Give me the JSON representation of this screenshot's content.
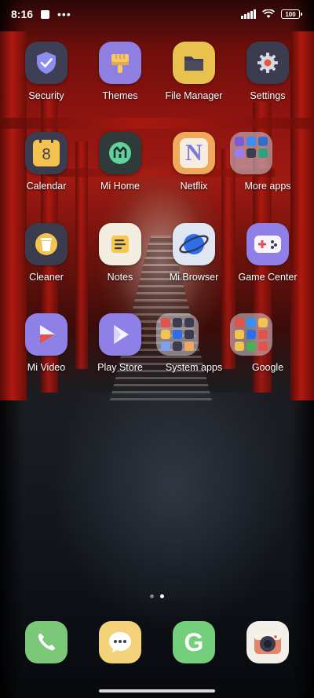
{
  "status_bar": {
    "time": "8:16",
    "battery": "100",
    "more_dots": "•••"
  },
  "apps": [
    {
      "label": "Security",
      "icon": "shield-icon"
    },
    {
      "label": "Themes",
      "icon": "paintbrush-icon"
    },
    {
      "label": "File Manager",
      "icon": "folder-icon"
    },
    {
      "label": "Settings",
      "icon": "gear-icon"
    },
    {
      "label": "Calendar",
      "icon": "calendar-icon",
      "day": "8"
    },
    {
      "label": "Mi Home",
      "icon": "mi-home-icon"
    },
    {
      "label": "Netflix",
      "icon": "netflix-icon",
      "letter": "N"
    },
    {
      "label": "More apps",
      "icon": "folder-grid-icon"
    },
    {
      "label": "Cleaner",
      "icon": "trash-icon"
    },
    {
      "label": "Notes",
      "icon": "notes-icon"
    },
    {
      "label": "Mi Browser",
      "icon": "planet-icon"
    },
    {
      "label": "Game Center",
      "icon": "gamepad-icon"
    },
    {
      "label": "Mi Video",
      "icon": "play-triangle-icon"
    },
    {
      "label": "Play Store",
      "icon": "play-store-icon"
    },
    {
      "label": "System apps",
      "icon": "folder-grid-icon"
    },
    {
      "label": "Google",
      "icon": "folder-grid-icon"
    }
  ],
  "dock": [
    {
      "name": "Phone",
      "icon": "phone-icon"
    },
    {
      "name": "Messages",
      "icon": "chat-bubble-icon"
    },
    {
      "name": "Google",
      "icon": "google-g-icon",
      "letter": "G"
    },
    {
      "name": "Camera",
      "icon": "camera-icon"
    }
  ],
  "page_indicator": {
    "pages": 2,
    "current": 2
  },
  "colors": {
    "security_tile": "#3e3f55",
    "themes_tile": "#8e7fe0",
    "file_manager_tile": "#e9c14f",
    "settings_tile": "#3b3c4f",
    "calendar_tile": "#3b3c4f",
    "mi_home_tile": "#2f3b3a",
    "netflix_tile": "#f0a85a",
    "cleaner_tile": "#3a3b4c",
    "notes_tile": "#f3ede0",
    "browser_tile": "#dfe6f2",
    "game_center_tile": "#8f7fe6",
    "mi_video_tile": "#8e80e6",
    "play_store_tile": "#8e80e6",
    "phone_dock": "#7cc879",
    "messages_dock": "#f4d27a",
    "google_dock": "#73cf7b",
    "camera_dock": "#f2efe8"
  }
}
